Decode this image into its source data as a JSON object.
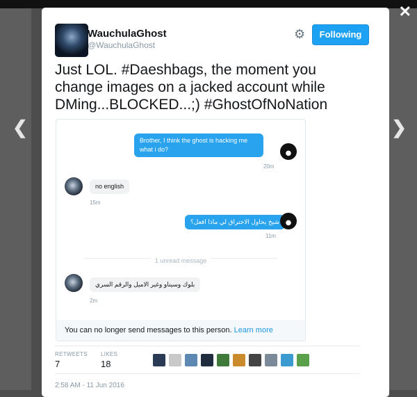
{
  "nav": {
    "prev_icon": "chevron-left-icon",
    "next_icon": "chevron-right-icon",
    "close_icon": "close-icon",
    "prev_glyph": "❮",
    "next_glyph": "❯",
    "close_glyph": "✕"
  },
  "tweet": {
    "author_name": "WauchulaGhost",
    "author_handle": "@WauchulaGhost",
    "follow_label": "Following",
    "gear_glyph": "⚙",
    "text": "Just LOL. #Daeshbags, the moment you change images on a jacked account while DMing...BLOCKED...;) #GhostOfNoNation",
    "retweets_label": "RETWEETS",
    "retweets_value": "7",
    "likes_label": "LIKES",
    "likes_value": "18",
    "timestamp": "2:58 AM - 11 Jun 2016"
  },
  "dm": {
    "messages": [
      {
        "text": "Brother, I think the ghost is hacking me what i do?",
        "time": "20m"
      },
      {
        "text": "no english",
        "time": "15m"
      },
      {
        "text": "شيخ يحاول الاختراق لي ماذا افعل؟",
        "time": "11m"
      },
      {
        "text": "بلوك وسيناو وغير الاميل والرقم السري",
        "time": "2m"
      }
    ],
    "unread_label": "1 unread message",
    "blocked_text": "You can no longer send messages to this person.",
    "learn_more": "Learn more"
  },
  "colors": {
    "accent": "#1da1f2",
    "bubble_out": "#2aa3ef",
    "muted": "#8899a6"
  }
}
